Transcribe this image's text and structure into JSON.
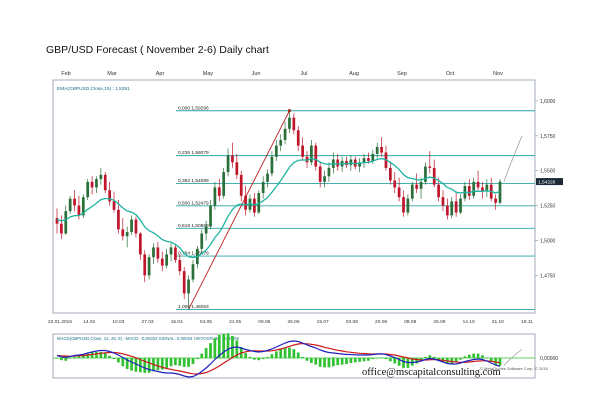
{
  "title": "GBP/USD Forecast ( November 2-6) Daily chart",
  "watermark": "office@mscapitalconsulting.com",
  "copyright": "© MetaQuotes Software Corp. © 2015",
  "colors": {
    "frame": "#8a9aa8",
    "fib_line": "#2aa5a5",
    "ema": "#1eb4a0",
    "bull_candle": "#2a6e3a",
    "bear_candle": "#c0162c",
    "trendline": "#b8211f",
    "macd_line": "#2020c0",
    "signal_line": "#cc1a1a",
    "histogram": "#2fc12f",
    "projection": "#9a9a9a",
    "price_tag_bg": "#1b2a36"
  },
  "chart_data": [
    {
      "type": "candlestick",
      "indicator_label": "EMA(GBPUSD,Close,15) : 1,5351",
      "month_labels": [
        "Feb",
        "Mar",
        "Apr",
        "May",
        "Jun",
        "Jul",
        "Aug",
        "Sep",
        "Oct",
        "Nov"
      ],
      "date_labels": [
        "22.01.2015",
        "14.02",
        "10.03",
        "27.03",
        "15.04",
        "04.05",
        "21.05",
        "09.06",
        "26.06",
        "15.07",
        "03.08",
        "20.08",
        "08.09",
        "25.09",
        "14.10",
        "31.10",
        "18.11"
      ],
      "y_ticks": [
        1.475,
        1.5,
        1.525,
        1.55,
        1.575,
        1.6
      ],
      "y_tick_labels": [
        "1,4750",
        "1,5000",
        "1,5250",
        "1,5500",
        "1,5750",
        "1,6000"
      ],
      "ylim": [
        1.448,
        1.615
      ],
      "last_price": 1.5422,
      "last_price_label": "1,54228",
      "fib_levels": [
        {
          "ratio": "0,000",
          "value": 1.59296
        },
        {
          "ratio": "0,236",
          "value": 1.56079
        },
        {
          "ratio": "0,382",
          "value": 1.54089
        },
        {
          "ratio": "0,500",
          "value": 1.52479
        },
        {
          "ratio": "0,618",
          "value": 1.50869
        },
        {
          "ratio": "0,764",
          "value": 1.48879
        },
        {
          "ratio": "1,000",
          "value": 1.45053
        }
      ],
      "fib_labels": [
        "0,000  1,59296",
        "0,236  1,56079",
        "0,382  1,54089",
        "0,500  1,52479",
        "0,618  1,50869",
        "0,764  1,48879",
        "1,000  1,45053"
      ],
      "swing_low": {
        "date": "13.04",
        "value": 1.45053
      },
      "swing_high": {
        "date": "18.06",
        "value": 1.59296
      },
      "ohlc": [
        {
          "o": 1.516,
          "h": 1.523,
          "l": 1.505,
          "c": 1.512
        },
        {
          "o": 1.512,
          "h": 1.518,
          "l": 1.501,
          "c": 1.505
        },
        {
          "o": 1.505,
          "h": 1.525,
          "l": 1.504,
          "c": 1.521
        },
        {
          "o": 1.521,
          "h": 1.532,
          "l": 1.519,
          "c": 1.53
        },
        {
          "o": 1.53,
          "h": 1.536,
          "l": 1.521,
          "c": 1.525
        },
        {
          "o": 1.525,
          "h": 1.532,
          "l": 1.515,
          "c": 1.518
        },
        {
          "o": 1.518,
          "h": 1.533,
          "l": 1.516,
          "c": 1.531
        },
        {
          "o": 1.531,
          "h": 1.544,
          "l": 1.529,
          "c": 1.542
        },
        {
          "o": 1.542,
          "h": 1.546,
          "l": 1.533,
          "c": 1.538
        },
        {
          "o": 1.538,
          "h": 1.546,
          "l": 1.534,
          "c": 1.544
        },
        {
          "o": 1.544,
          "h": 1.552,
          "l": 1.54,
          "c": 1.547
        },
        {
          "o": 1.547,
          "h": 1.549,
          "l": 1.534,
          "c": 1.536
        },
        {
          "o": 1.536,
          "h": 1.542,
          "l": 1.525,
          "c": 1.528
        },
        {
          "o": 1.528,
          "h": 1.535,
          "l": 1.52,
          "c": 1.522
        },
        {
          "o": 1.522,
          "h": 1.529,
          "l": 1.505,
          "c": 1.508
        },
        {
          "o": 1.508,
          "h": 1.516,
          "l": 1.5,
          "c": 1.503
        },
        {
          "o": 1.503,
          "h": 1.51,
          "l": 1.495,
          "c": 1.506
        },
        {
          "o": 1.506,
          "h": 1.518,
          "l": 1.504,
          "c": 1.515
        },
        {
          "o": 1.515,
          "h": 1.517,
          "l": 1.502,
          "c": 1.505
        },
        {
          "o": 1.505,
          "h": 1.506,
          "l": 1.486,
          "c": 1.49
        },
        {
          "o": 1.49,
          "h": 1.493,
          "l": 1.47,
          "c": 1.475
        },
        {
          "o": 1.475,
          "h": 1.49,
          "l": 1.472,
          "c": 1.488
        },
        {
          "o": 1.488,
          "h": 1.498,
          "l": 1.483,
          "c": 1.495
        },
        {
          "o": 1.495,
          "h": 1.499,
          "l": 1.484,
          "c": 1.487
        },
        {
          "o": 1.487,
          "h": 1.492,
          "l": 1.478,
          "c": 1.482
        },
        {
          "o": 1.482,
          "h": 1.494,
          "l": 1.48,
          "c": 1.49
        },
        {
          "o": 1.49,
          "h": 1.498,
          "l": 1.485,
          "c": 1.495
        },
        {
          "o": 1.495,
          "h": 1.497,
          "l": 1.484,
          "c": 1.486
        },
        {
          "o": 1.486,
          "h": 1.49,
          "l": 1.475,
          "c": 1.478
        },
        {
          "o": 1.478,
          "h": 1.481,
          "l": 1.458,
          "c": 1.462
        },
        {
          "o": 1.462,
          "h": 1.475,
          "l": 1.4505,
          "c": 1.472
        },
        {
          "o": 1.472,
          "h": 1.486,
          "l": 1.47,
          "c": 1.483
        },
        {
          "o": 1.483,
          "h": 1.496,
          "l": 1.48,
          "c": 1.494
        },
        {
          "o": 1.494,
          "h": 1.508,
          "l": 1.491,
          "c": 1.505
        },
        {
          "o": 1.505,
          "h": 1.514,
          "l": 1.5,
          "c": 1.51
        },
        {
          "o": 1.51,
          "h": 1.529,
          "l": 1.508,
          "c": 1.525
        },
        {
          "o": 1.525,
          "h": 1.542,
          "l": 1.522,
          "c": 1.538
        },
        {
          "o": 1.538,
          "h": 1.544,
          "l": 1.528,
          "c": 1.532
        },
        {
          "o": 1.532,
          "h": 1.552,
          "l": 1.53,
          "c": 1.549
        },
        {
          "o": 1.549,
          "h": 1.566,
          "l": 1.546,
          "c": 1.561
        },
        {
          "o": 1.561,
          "h": 1.57,
          "l": 1.552,
          "c": 1.556
        },
        {
          "o": 1.556,
          "h": 1.562,
          "l": 1.544,
          "c": 1.547
        },
        {
          "o": 1.547,
          "h": 1.55,
          "l": 1.528,
          "c": 1.532
        },
        {
          "o": 1.532,
          "h": 1.539,
          "l": 1.518,
          "c": 1.522
        },
        {
          "o": 1.522,
          "h": 1.533,
          "l": 1.52,
          "c": 1.53
        },
        {
          "o": 1.53,
          "h": 1.534,
          "l": 1.517,
          "c": 1.52
        },
        {
          "o": 1.52,
          "h": 1.536,
          "l": 1.519,
          "c": 1.534
        },
        {
          "o": 1.534,
          "h": 1.546,
          "l": 1.53,
          "c": 1.542
        },
        {
          "o": 1.542,
          "h": 1.551,
          "l": 1.538,
          "c": 1.548
        },
        {
          "o": 1.548,
          "h": 1.564,
          "l": 1.546,
          "c": 1.56
        },
        {
          "o": 1.56,
          "h": 1.572,
          "l": 1.557,
          "c": 1.568
        },
        {
          "o": 1.568,
          "h": 1.576,
          "l": 1.564,
          "c": 1.572
        },
        {
          "o": 1.572,
          "h": 1.585,
          "l": 1.569,
          "c": 1.58
        },
        {
          "o": 1.58,
          "h": 1.593,
          "l": 1.577,
          "c": 1.588
        },
        {
          "o": 1.588,
          "h": 1.591,
          "l": 1.576,
          "c": 1.579
        },
        {
          "o": 1.579,
          "h": 1.582,
          "l": 1.564,
          "c": 1.568
        },
        {
          "o": 1.568,
          "h": 1.574,
          "l": 1.557,
          "c": 1.56
        },
        {
          "o": 1.56,
          "h": 1.564,
          "l": 1.552,
          "c": 1.556
        },
        {
          "o": 1.556,
          "h": 1.572,
          "l": 1.554,
          "c": 1.568
        },
        {
          "o": 1.568,
          "h": 1.57,
          "l": 1.55,
          "c": 1.553
        },
        {
          "o": 1.553,
          "h": 1.556,
          "l": 1.538,
          "c": 1.542
        },
        {
          "o": 1.542,
          "h": 1.55,
          "l": 1.538,
          "c": 1.546
        },
        {
          "o": 1.546,
          "h": 1.556,
          "l": 1.542,
          "c": 1.552
        },
        {
          "o": 1.552,
          "h": 1.563,
          "l": 1.548,
          "c": 1.558
        },
        {
          "o": 1.558,
          "h": 1.562,
          "l": 1.55,
          "c": 1.553
        },
        {
          "o": 1.553,
          "h": 1.56,
          "l": 1.549,
          "c": 1.557
        },
        {
          "o": 1.557,
          "h": 1.56,
          "l": 1.552,
          "c": 1.554
        },
        {
          "o": 1.554,
          "h": 1.561,
          "l": 1.55,
          "c": 1.558
        },
        {
          "o": 1.558,
          "h": 1.56,
          "l": 1.551,
          "c": 1.553
        },
        {
          "o": 1.553,
          "h": 1.559,
          "l": 1.549,
          "c": 1.556
        },
        {
          "o": 1.556,
          "h": 1.562,
          "l": 1.552,
          "c": 1.559
        },
        {
          "o": 1.559,
          "h": 1.563,
          "l": 1.555,
          "c": 1.557
        },
        {
          "o": 1.557,
          "h": 1.565,
          "l": 1.555,
          "c": 1.562
        },
        {
          "o": 1.562,
          "h": 1.57,
          "l": 1.559,
          "c": 1.567
        },
        {
          "o": 1.567,
          "h": 1.574,
          "l": 1.56,
          "c": 1.563
        },
        {
          "o": 1.563,
          "h": 1.568,
          "l": 1.55,
          "c": 1.552
        },
        {
          "o": 1.552,
          "h": 1.556,
          "l": 1.54,
          "c": 1.543
        },
        {
          "o": 1.543,
          "h": 1.549,
          "l": 1.534,
          "c": 1.538
        },
        {
          "o": 1.538,
          "h": 1.545,
          "l": 1.528,
          "c": 1.531
        },
        {
          "o": 1.531,
          "h": 1.536,
          "l": 1.517,
          "c": 1.52
        },
        {
          "o": 1.52,
          "h": 1.533,
          "l": 1.518,
          "c": 1.53
        },
        {
          "o": 1.53,
          "h": 1.542,
          "l": 1.528,
          "c": 1.54
        },
        {
          "o": 1.54,
          "h": 1.548,
          "l": 1.534,
          "c": 1.537
        },
        {
          "o": 1.537,
          "h": 1.545,
          "l": 1.53,
          "c": 1.542
        },
        {
          "o": 1.542,
          "h": 1.556,
          "l": 1.54,
          "c": 1.553
        },
        {
          "o": 1.553,
          "h": 1.564,
          "l": 1.548,
          "c": 1.552
        },
        {
          "o": 1.552,
          "h": 1.558,
          "l": 1.538,
          "c": 1.54
        },
        {
          "o": 1.54,
          "h": 1.545,
          "l": 1.528,
          "c": 1.531
        },
        {
          "o": 1.531,
          "h": 1.536,
          "l": 1.521,
          "c": 1.525
        },
        {
          "o": 1.525,
          "h": 1.53,
          "l": 1.515,
          "c": 1.518
        },
        {
          "o": 1.518,
          "h": 1.531,
          "l": 1.516,
          "c": 1.528
        },
        {
          "o": 1.528,
          "h": 1.535,
          "l": 1.517,
          "c": 1.52
        },
        {
          "o": 1.52,
          "h": 1.533,
          "l": 1.519,
          "c": 1.53
        },
        {
          "o": 1.53,
          "h": 1.542,
          "l": 1.528,
          "c": 1.539
        },
        {
          "o": 1.539,
          "h": 1.544,
          "l": 1.529,
          "c": 1.532
        },
        {
          "o": 1.532,
          "h": 1.545,
          "l": 1.53,
          "c": 1.542
        },
        {
          "o": 1.542,
          "h": 1.55,
          "l": 1.536,
          "c": 1.538
        },
        {
          "o": 1.538,
          "h": 1.542,
          "l": 1.53,
          "c": 1.535
        },
        {
          "o": 1.535,
          "h": 1.544,
          "l": 1.531,
          "c": 1.54
        },
        {
          "o": 1.54,
          "h": 1.545,
          "l": 1.528,
          "c": 1.53
        },
        {
          "o": 1.53,
          "h": 1.533,
          "l": 1.522,
          "c": 1.527
        },
        {
          "o": 1.527,
          "h": 1.544,
          "l": 1.526,
          "c": 1.5422
        }
      ],
      "ema": [
        1.515,
        1.514,
        1.5149,
        1.5168,
        1.5178,
        1.5178,
        1.5195,
        1.5223,
        1.5243,
        1.5268,
        1.5293,
        1.5301,
        1.5298,
        1.5288,
        1.5262,
        1.5233,
        1.5211,
        1.5203,
        1.5184,
        1.5148,
        1.5098,
        1.507,
        1.5055,
        1.5032,
        1.5006,
        1.4993,
        1.4988,
        1.4972,
        1.4948,
        1.4907,
        1.4884,
        1.4877,
        1.4885,
        1.4906,
        1.493,
        1.497,
        1.5021,
        1.5058,
        1.5112,
        1.5174,
        1.5222,
        1.5253,
        1.5262,
        1.5257,
        1.5263,
        1.5255,
        1.5265,
        1.5284,
        1.5308,
        1.5345,
        1.5387,
        1.5429,
        1.5476,
        1.5526,
        1.5559,
        1.5574,
        1.5577,
        1.5575,
        1.5588,
        1.5581,
        1.5561,
        1.5549,
        1.5546,
        1.555,
        1.5548,
        1.5551,
        1.555,
        1.5554,
        1.5551,
        1.5553,
        1.5558,
        1.556,
        1.5568,
        1.5581,
        1.5587,
        1.5579,
        1.556,
        1.5537,
        1.5509,
        1.5471,
        1.545,
        1.5444,
        1.5435,
        1.5433,
        1.5445,
        1.5454,
        1.5447,
        1.543,
        1.5408,
        1.5379,
        1.5367,
        1.5346,
        1.534,
        1.5346,
        1.5343,
        1.5353,
        1.5352,
        1.5352,
        1.5358,
        1.5351,
        1.5341,
        1.5351
      ]
    },
    {
      "type": "macd",
      "label": "MACD(GBPUSD,Close, 12, 26, 9) : MACD: -0,00332  SIGNAL: 0,00034  HISTOGRAM: -0,00006",
      "zero_line_label": "0,00000",
      "macd": [
        0.001,
        0.0005,
        0.0003,
        0.0006,
        0.001,
        0.0012,
        0.0015,
        0.002,
        0.0024,
        0.0028,
        0.003,
        0.003,
        0.0026,
        0.002,
        0.0012,
        0.0002,
        -0.0008,
        -0.0016,
        -0.0024,
        -0.0032,
        -0.004,
        -0.0046,
        -0.005,
        -0.0054,
        -0.0058,
        -0.006,
        -0.006,
        -0.0062,
        -0.0066,
        -0.0072,
        -0.0076,
        -0.0074,
        -0.0066,
        -0.0054,
        -0.004,
        -0.0024,
        -0.0006,
        0.001,
        0.0024,
        0.0036,
        0.0042,
        0.0044,
        0.004,
        0.0034,
        0.003,
        0.0026,
        0.0024,
        0.0026,
        0.003,
        0.0036,
        0.0044,
        0.0052,
        0.006,
        0.0066,
        0.0068,
        0.0066,
        0.006,
        0.0052,
        0.0046,
        0.004,
        0.0032,
        0.0026,
        0.0022,
        0.002,
        0.0018,
        0.0016,
        0.0014,
        0.0014,
        0.0013,
        0.0012,
        0.0012,
        0.0012,
        0.0014,
        0.0016,
        0.0017,
        0.0014,
        0.0008,
        0.0002,
        -0.0006,
        -0.0014,
        -0.0018,
        -0.0018,
        -0.0016,
        -0.0012,
        -0.0006,
        -0.0002,
        -0.0004,
        -0.001,
        -0.0016,
        -0.0022,
        -0.0024,
        -0.0024,
        -0.002,
        -0.0014,
        -0.001,
        -0.0006,
        -0.0004,
        -0.0006,
        -0.0012,
        -0.002,
        -0.0028,
        -0.0033
      ],
      "signal": [
        0.001,
        0.0009,
        0.0008,
        0.0007,
        0.0008,
        0.0009,
        0.001,
        0.0012,
        0.0014,
        0.0017,
        0.0019,
        0.0021,
        0.0022,
        0.0022,
        0.002,
        0.0017,
        0.0012,
        0.0007,
        0.0001,
        -0.0006,
        -0.0013,
        -0.0019,
        -0.0026,
        -0.0032,
        -0.0037,
        -0.0042,
        -0.0045,
        -0.0049,
        -0.0052,
        -0.0056,
        -0.006,
        -0.0063,
        -0.0064,
        -0.0062,
        -0.0058,
        -0.0051,
        -0.0042,
        -0.0032,
        -0.002,
        -0.0009,
        0.0002,
        0.0012,
        0.002,
        0.0025,
        0.0028,
        0.0029,
        0.0028,
        0.0028,
        0.0028,
        0.0029,
        0.0032,
        0.0036,
        0.0041,
        0.0047,
        0.0052,
        0.0056,
        0.0058,
        0.0057,
        0.0055,
        0.0052,
        0.0048,
        0.0043,
        0.0039,
        0.0035,
        0.0031,
        0.0028,
        0.0025,
        0.0023,
        0.0021,
        0.0019,
        0.0018,
        0.0017,
        0.0016,
        0.0016,
        0.0016,
        0.0016,
        0.0014,
        0.0012,
        0.0008,
        0.0004,
        0.0,
        -0.0004,
        -0.0006,
        -0.0008,
        -0.0008,
        -0.0007,
        -0.0006,
        -0.0007,
        -0.0009,
        -0.0012,
        -0.0014,
        -0.0016,
        -0.0017,
        -0.0017,
        -0.0016,
        -0.0014,
        -0.0012,
        -0.0011,
        -0.0011,
        -0.0013,
        -0.0016,
        -0.0019
      ]
    }
  ]
}
